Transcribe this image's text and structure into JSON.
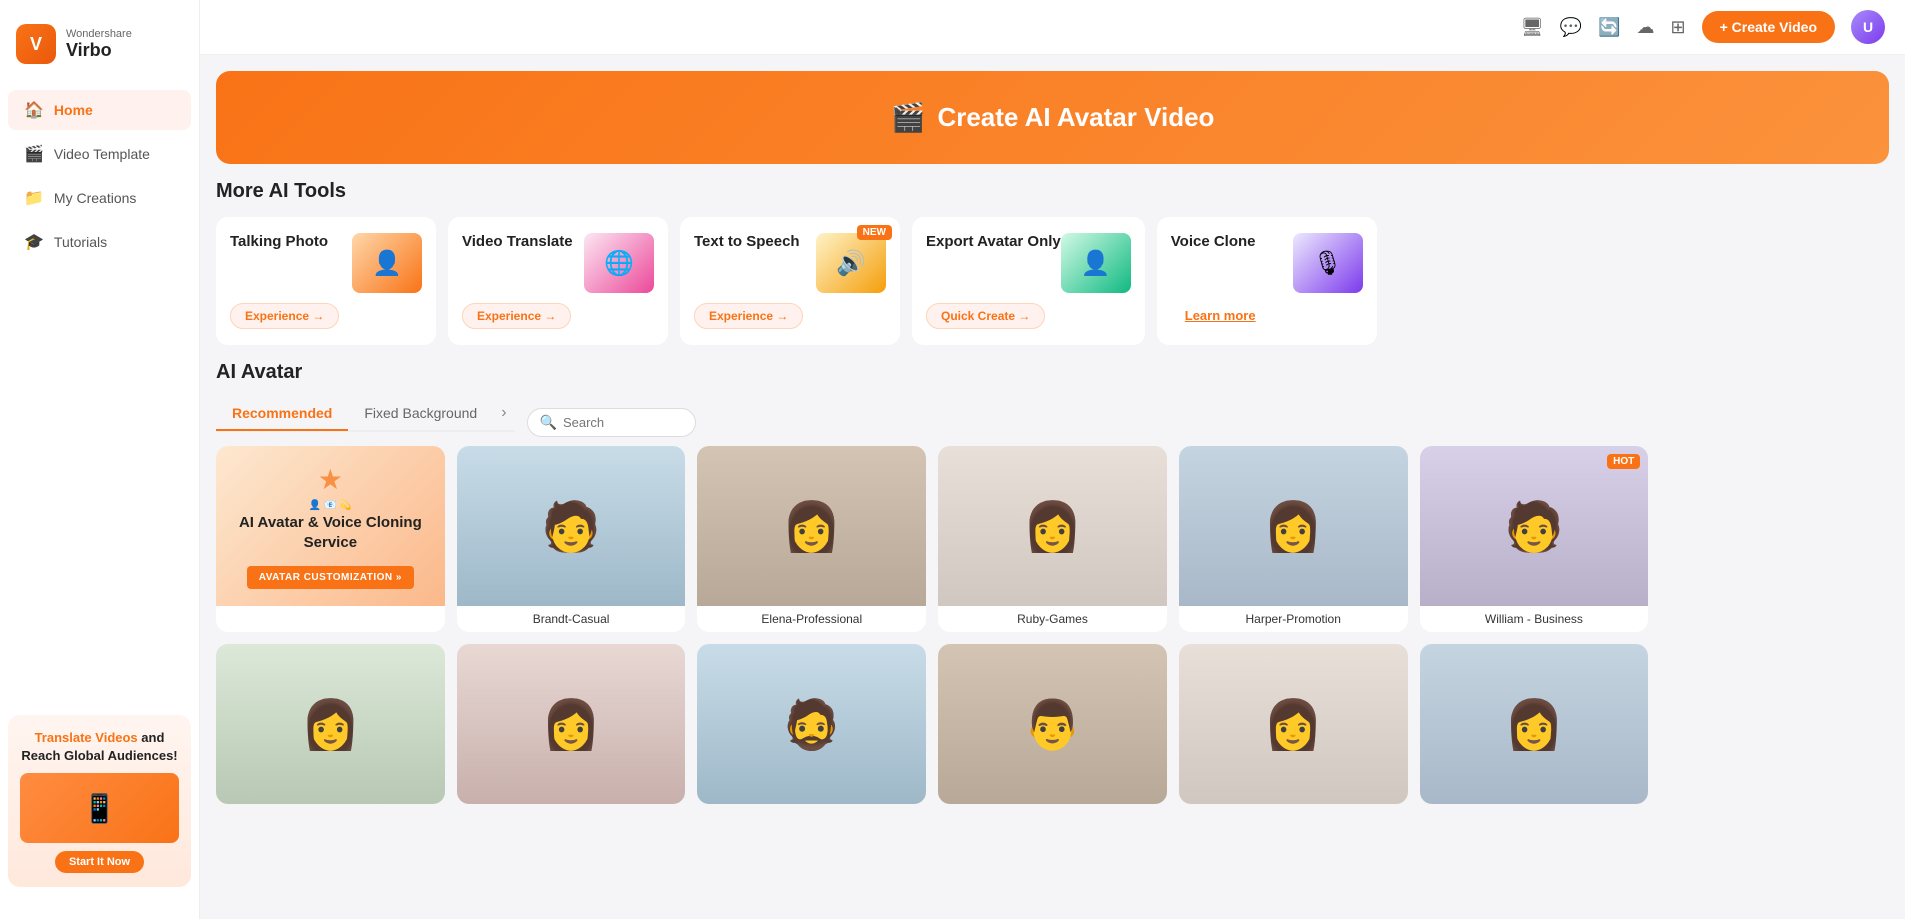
{
  "app": {
    "brand_company": "Wondershare",
    "brand_name": "Virbo"
  },
  "sidebar": {
    "nav_items": [
      {
        "id": "home",
        "label": "Home",
        "icon": "🏠",
        "active": true
      },
      {
        "id": "video-template",
        "label": "Video Template",
        "icon": "🎬",
        "active": false
      },
      {
        "id": "my-creations",
        "label": "My Creations",
        "icon": "🎓",
        "active": false
      },
      {
        "id": "tutorials",
        "label": "Tutorials",
        "icon": "🎓",
        "active": false
      }
    ],
    "banner": {
      "title_colored": "Translate Videos",
      "title_rest": " and Reach Global Audiences!",
      "button_label": "Start It Now"
    }
  },
  "header": {
    "create_button": "+ Create Video",
    "icons": [
      "monitor",
      "chat",
      "refresh",
      "cloud",
      "grid"
    ]
  },
  "hero": {
    "text": "Create AI Avatar Video",
    "icon": "🎬"
  },
  "more_ai_tools": {
    "section_title": "More AI Tools",
    "tools": [
      {
        "id": "talking-photo",
        "name": "Talking Photo",
        "button_label": "Experience →",
        "badge": null
      },
      {
        "id": "video-translate",
        "name": "Video Translate",
        "button_label": "Experience →",
        "badge": null
      },
      {
        "id": "text-to-speech",
        "name": "Text to Speech",
        "button_label": "Experience →",
        "badge": "NEW"
      },
      {
        "id": "export-avatar",
        "name": "Export Avatar Only",
        "button_label": "Quick Create →",
        "badge": null
      },
      {
        "id": "voice-clone",
        "name": "Voice Clone",
        "button_label": "Learn more",
        "badge": null
      }
    ]
  },
  "ai_avatar": {
    "section_title": "AI Avatar",
    "tabs": [
      {
        "id": "recommended",
        "label": "Recommended",
        "active": true
      },
      {
        "id": "fixed-bg",
        "label": "Fixed Background",
        "active": false
      }
    ],
    "search_placeholder": "Search",
    "promo_card": {
      "title": "AI Avatar & Voice Cloning Service",
      "button_label": "AVATAR CUSTOMIZATION »",
      "star": "★"
    },
    "avatars_row1": [
      {
        "id": "brandt",
        "name": "Brandt-Casual",
        "hot": false,
        "bg": "person-bg-1"
      },
      {
        "id": "elena",
        "name": "Elena-Professional",
        "hot": false,
        "bg": "person-bg-2"
      },
      {
        "id": "ruby",
        "name": "Ruby-Games",
        "hot": false,
        "bg": "person-bg-3"
      },
      {
        "id": "harper",
        "name": "Harper-Promotion",
        "hot": false,
        "bg": "person-bg-4"
      },
      {
        "id": "william",
        "name": "William - Business",
        "hot": true,
        "bg": "person-bg-5"
      }
    ],
    "avatars_row2": [
      {
        "id": "av6",
        "name": "",
        "hot": false,
        "bg": "person-bg-6"
      },
      {
        "id": "av7",
        "name": "",
        "hot": false,
        "bg": "person-bg-7"
      },
      {
        "id": "av8",
        "name": "",
        "hot": false,
        "bg": "person-bg-1"
      },
      {
        "id": "av9",
        "name": "",
        "hot": false,
        "bg": "person-bg-2"
      },
      {
        "id": "av10",
        "name": "",
        "hot": false,
        "bg": "person-bg-3"
      },
      {
        "id": "av11",
        "name": "",
        "hot": false,
        "bg": "person-bg-4"
      }
    ]
  }
}
